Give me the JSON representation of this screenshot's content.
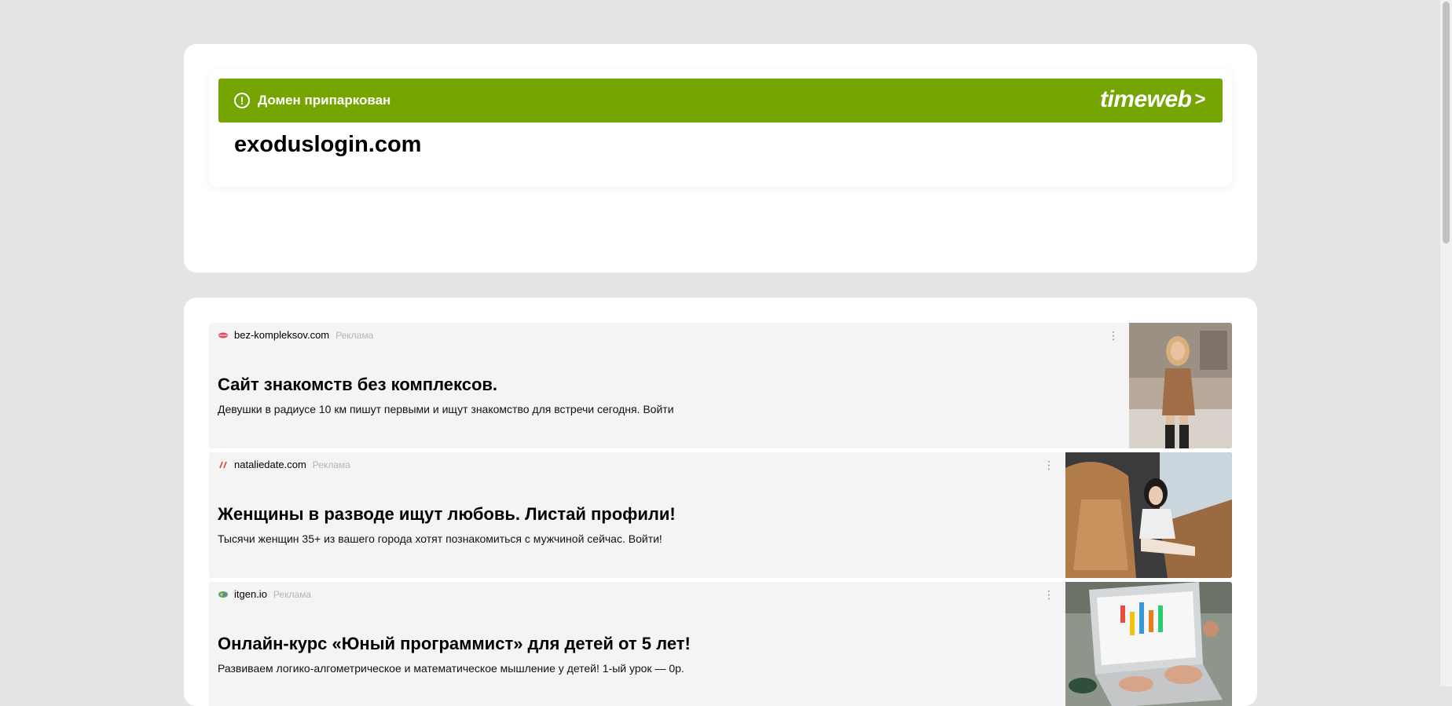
{
  "parking": {
    "banner_text": "Домен припаркован",
    "brand": "timeweb",
    "brand_arrow": ">",
    "alert_glyph": "!",
    "domain": "exoduslogin.com",
    "banner_color": "#75a500"
  },
  "ads": [
    {
      "source": "bez-kompleksov.com",
      "label": "Реклама",
      "headline": "Сайт знакомств без комплексов.",
      "description": "Девушки в радиусе 10 км пишут первыми и ищут знакомство для встречи сегодня. Войти",
      "favicon": "lips-icon",
      "image": "woman-in-brown-dress-photo"
    },
    {
      "source": "nataliedate.com",
      "label": "Реклама",
      "headline": "Женщины в разводе ищут любовь. Листай профили!",
      "description": "Тысячи женщин 35+ из вашего города хотят познакомиться с мужчиной сейчас. Войти!",
      "favicon": "nataliedate-logo-icon",
      "image": "woman-in-car-photo"
    },
    {
      "source": "itgen.io",
      "label": "Реклама",
      "headline": "Онлайн-курс «Юный программист» для детей от 5 лет!",
      "description": "Развиваем логико-алгометрическое и математическое мышление у детей! 1-ый урок — 0р.",
      "favicon": "itgen-logo-icon",
      "image": "laptop-coding-photo"
    }
  ],
  "menu_glyph": "⋮"
}
